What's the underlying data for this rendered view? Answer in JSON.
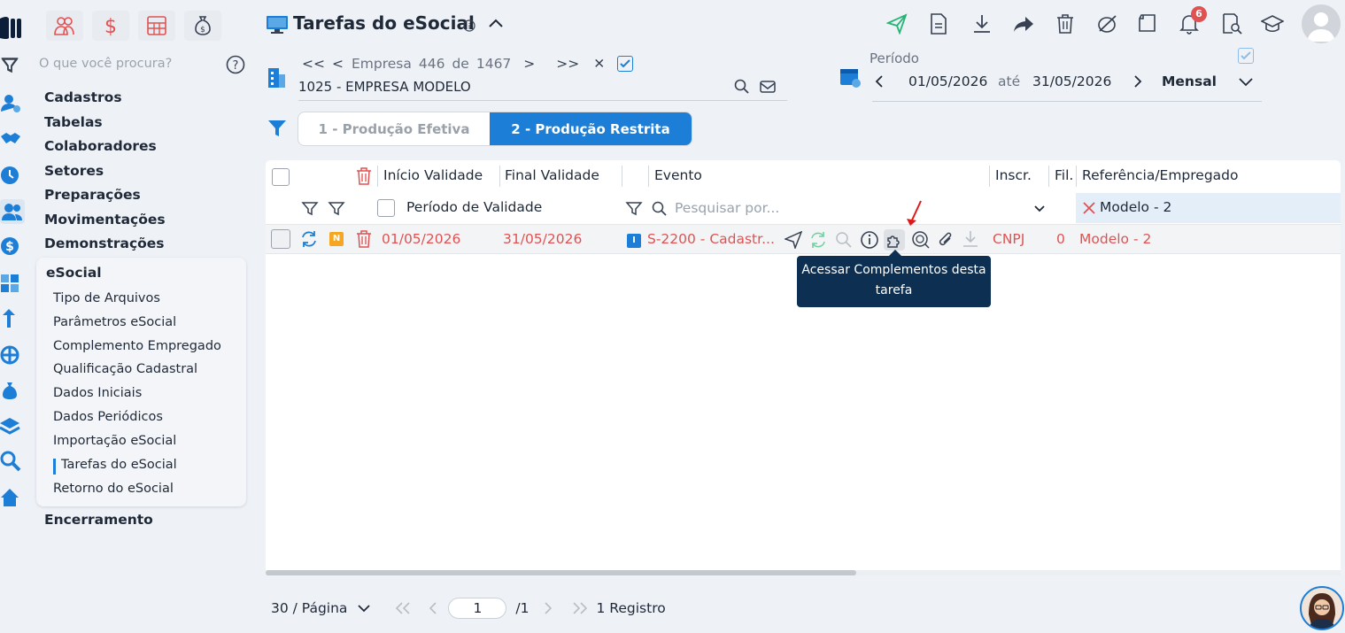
{
  "app": {
    "title": "Tarefas do eSocial"
  },
  "search": {
    "placeholder": "O que você procura?"
  },
  "nav": {
    "items": [
      "Cadastros",
      "Tabelas",
      "Colaboradores",
      "Setores",
      "Preparações",
      "Movimentações",
      "Demonstrações"
    ],
    "group_title": "eSocial",
    "sub_items": [
      "Tipo de Arquivos",
      "Parâmetros eSocial",
      "Complemento Empregado",
      "Qualificação Cadastral",
      "Dados Iniciais",
      "Dados Periódicos",
      "Importação eSocial",
      "Tarefas do eSocial",
      "Retorno do eSocial"
    ],
    "selected_index": 7,
    "last_item": "Encerramento"
  },
  "company": {
    "label": "Empresa",
    "current": "446",
    "of": "de",
    "total": "1467",
    "name": "1025 - EMPRESA MODELO",
    "prev": "<",
    "first": "<<",
    "next": ">",
    "last": ">>",
    "clear": "✕"
  },
  "period": {
    "label": "Período",
    "start": "01/05/2026",
    "to": "até",
    "end": "31/05/2026",
    "mode": "Mensal"
  },
  "tabs": [
    {
      "label": "1 - Produção Efetiva",
      "active": false
    },
    {
      "label": "2 - Produção Restrita",
      "active": true
    }
  ],
  "notifications": {
    "count": "6"
  },
  "grid": {
    "columns": [
      "Início Validade",
      "Final Validade",
      "Evento",
      "Inscr.",
      "Fil.",
      "Referência/Empregado"
    ],
    "filter": {
      "validity_label": "Período de Validade",
      "search_placeholder": "Pesquisar por...",
      "reference_value": "Modelo - 2"
    },
    "rows": [
      {
        "badge": "N",
        "start": "01/05/2026",
        "end": "31/05/2026",
        "event_badge": "I",
        "event": "S-2200 - Cadastr...",
        "inscr": "CNPJ",
        "fil": "0",
        "ref": "Modelo - 2"
      }
    ]
  },
  "tooltip": {
    "line1": "Acessar Complementos desta",
    "line2": "tarefa"
  },
  "pager": {
    "per_page": "30 / Página",
    "page": "1",
    "total_pages": "/1",
    "records": "1 Registro"
  },
  "colors": {
    "accent": "#1c7ed6",
    "danger": "#e05252",
    "tooltip": "#0d2f52",
    "badge_orange": "#f5a623"
  }
}
